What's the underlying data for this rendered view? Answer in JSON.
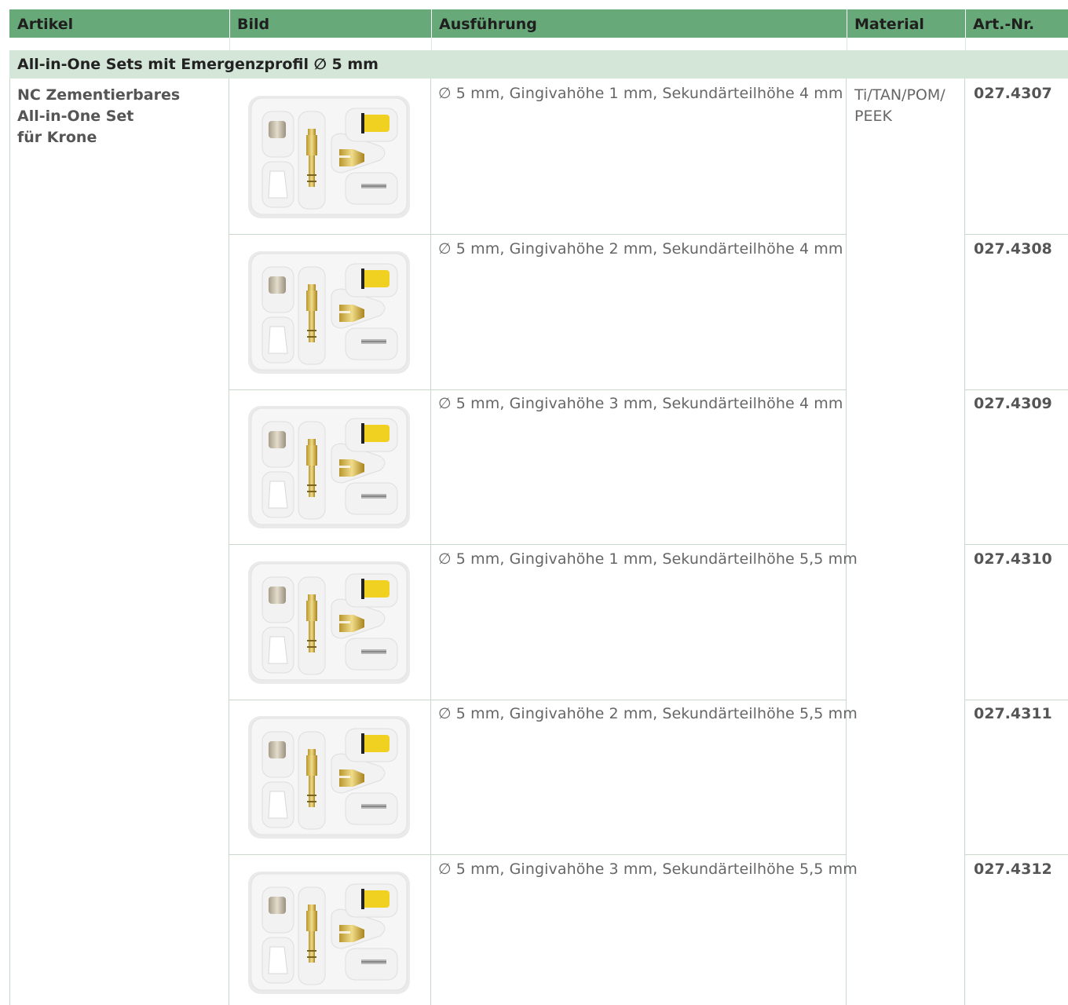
{
  "header": {
    "columns": [
      "Artikel",
      "Bild",
      "Ausführung",
      "Material",
      "Art.-Nr."
    ],
    "bg_color": "#68a979"
  },
  "section": {
    "title": "All-in-One Sets mit Emergenzprofil ∅ 5 mm",
    "bg_color": "#d4e6d8"
  },
  "article": {
    "lines": [
      "NC Zementierbares",
      "All-in-One Set",
      "für Krone"
    ]
  },
  "material": {
    "lines": [
      "Ti/TAN/POM/",
      "PEEK"
    ]
  },
  "rows": [
    {
      "ausfuehrung": "∅ 5 mm, Gingivahöhe 1 mm, Sekundärteilhöhe 4 mm",
      "art_nr": "027.4307",
      "image": "tray-icon"
    },
    {
      "ausfuehrung": "∅ 5 mm, Gingivahöhe 2 mm, Sekundärteilhöhe 4 mm",
      "art_nr": "027.4308",
      "image": "tray-icon"
    },
    {
      "ausfuehrung": "∅ 5 mm, Gingivahöhe 3 mm, Sekundärteilhöhe 4 mm",
      "art_nr": "027.4309",
      "image": "tray-icon"
    },
    {
      "ausfuehrung": "∅ 5 mm, Gingivahöhe 1 mm, Sekundärteilhöhe 5,5 mm",
      "art_nr": "027.4310",
      "image": "tray-icon"
    },
    {
      "ausfuehrung": "∅ 5 mm, Gingivahöhe 2 mm, Sekundärteilhöhe 5,5 mm",
      "art_nr": "027.4311",
      "image": "tray-icon"
    },
    {
      "ausfuehrung": "∅ 5 mm, Gingivahöhe 3 mm, Sekundärteilhöhe 5,5 mm",
      "art_nr": "027.4312",
      "image": "tray-icon"
    }
  ]
}
